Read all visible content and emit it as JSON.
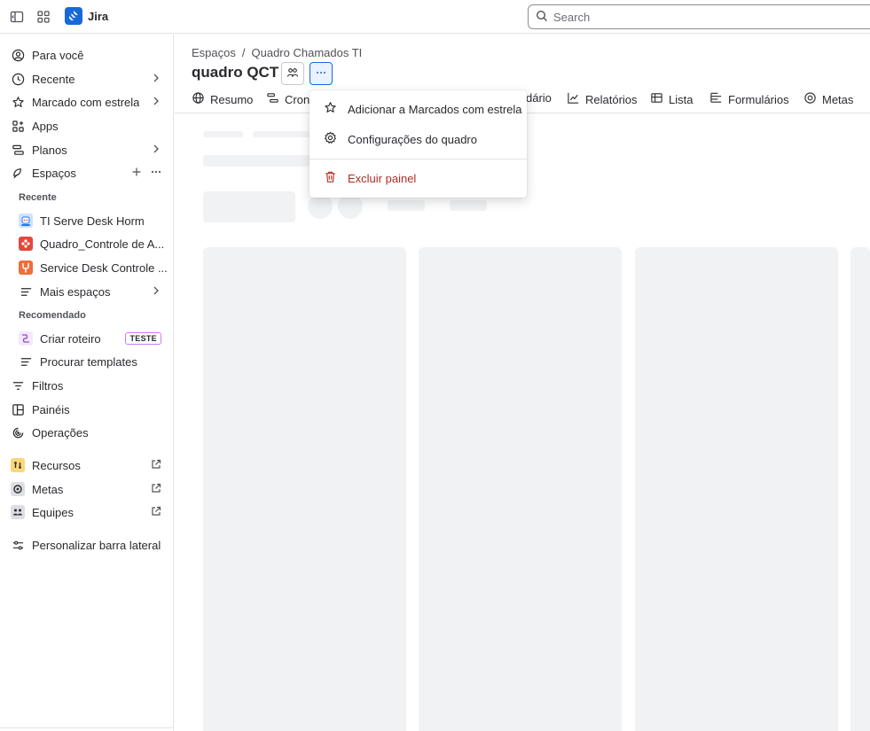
{
  "app": {
    "name": "Jira"
  },
  "search": {
    "placeholder": "Search"
  },
  "sidebar": {
    "items": {
      "for_you": "Para você",
      "recent": "Recente",
      "starred": "Marcado com estrela",
      "apps": "Apps",
      "plans": "Planos",
      "spaces": "Espaços"
    },
    "recent_section": "Recente",
    "recent_spaces": [
      {
        "label": "TI Serve Desk Horm",
        "icon": "robot-icon",
        "color": "#1d7afc"
      },
      {
        "label": "Quadro_Controle de A...",
        "icon": "dots-icon",
        "color": "#e2483d"
      },
      {
        "label": "Service Desk Controle ...",
        "icon": "wrench-icon",
        "color": "#e56910"
      }
    ],
    "more_spaces": "Mais espaços",
    "recommended_section": "Recomendado",
    "create_roadmap": "Criar roteiro",
    "create_roadmap_badge": "TESTE",
    "browse_templates": "Procurar templates",
    "filters": "Filtros",
    "dashboards": "Painéis",
    "operations": "Operações",
    "resources": "Recursos",
    "goals": "Metas",
    "teams": "Equipes",
    "customize": "Personalizar barra lateral"
  },
  "header": {
    "breadcrumb": [
      "Espaços",
      "/",
      "Quadro Chamados TI"
    ],
    "title": "quadro QCT"
  },
  "tabs": [
    "Resumo",
    "Cron",
    "dário",
    "Relatórios",
    "Lista",
    "Formulários",
    "Metas"
  ],
  "menu": {
    "add_starred": "Adicionar a Marcados com estrela",
    "board_settings": "Configurações do quadro",
    "delete_board": "Excluir painel"
  },
  "colors": {
    "accent": "#1868db",
    "danger": "#ae2e24",
    "skeleton": "#f1f2f4"
  }
}
